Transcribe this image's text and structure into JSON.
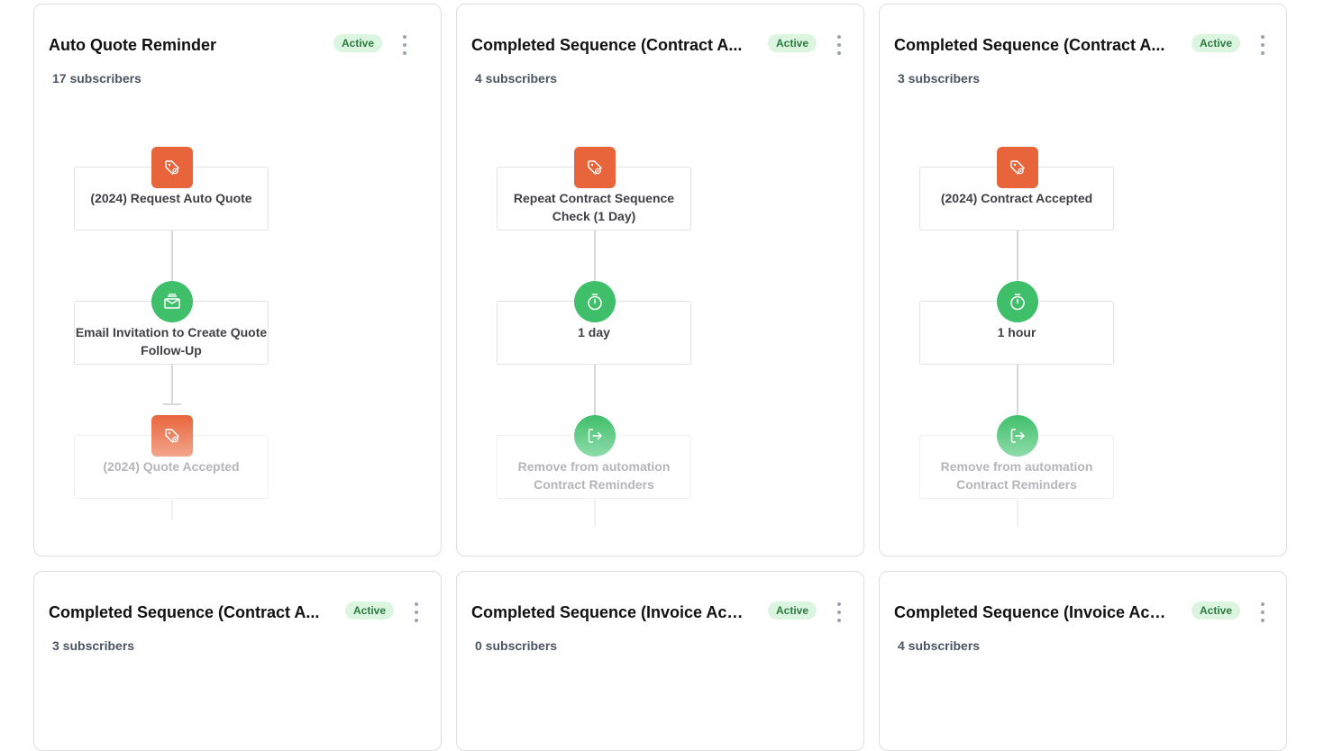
{
  "status_colors": {
    "active_bg": "#dcf5e0",
    "active_text": "#2c7a3f",
    "tag_icon": "#e8653c",
    "green_icon": "#3fbf6a"
  },
  "cards": [
    {
      "title": "Auto Quote Reminder",
      "status": "Active",
      "subscribers": "17 subscribers",
      "steps": [
        {
          "icon": "tag-icon",
          "label": "(2024) Request Auto Quote"
        },
        {
          "icon": "email-icon",
          "label": "Email Invitation to Create Quote Follow-Up"
        },
        {
          "icon": "tag-icon",
          "label": "(2024) Quote Accepted"
        }
      ]
    },
    {
      "title": "Completed Sequence (Contract A...",
      "status": "Active",
      "subscribers": "4 subscribers",
      "steps": [
        {
          "icon": "tag-icon",
          "label": "Repeat Contract Sequence Check (1 Day)"
        },
        {
          "icon": "timer-icon",
          "label": "1 day"
        },
        {
          "icon": "exit-icon",
          "label": "Remove from automation Contract Reminders"
        }
      ]
    },
    {
      "title": "Completed Sequence (Contract A...",
      "status": "Active",
      "subscribers": "3 subscribers",
      "steps": [
        {
          "icon": "tag-icon",
          "label": "(2024) Contract Accepted"
        },
        {
          "icon": "timer-icon",
          "label": "1 hour"
        },
        {
          "icon": "exit-icon",
          "label": "Remove from automation Contract Reminders"
        }
      ]
    },
    {
      "title": "Completed Sequence (Contract A...",
      "status": "Active",
      "subscribers": "3 subscribers"
    },
    {
      "title": "Completed Sequence (Invoice Acc...",
      "status": "Active",
      "subscribers": "0 subscribers"
    },
    {
      "title": "Completed Sequence (Invoice Acc...",
      "status": "Active",
      "subscribers": "4 subscribers"
    }
  ]
}
